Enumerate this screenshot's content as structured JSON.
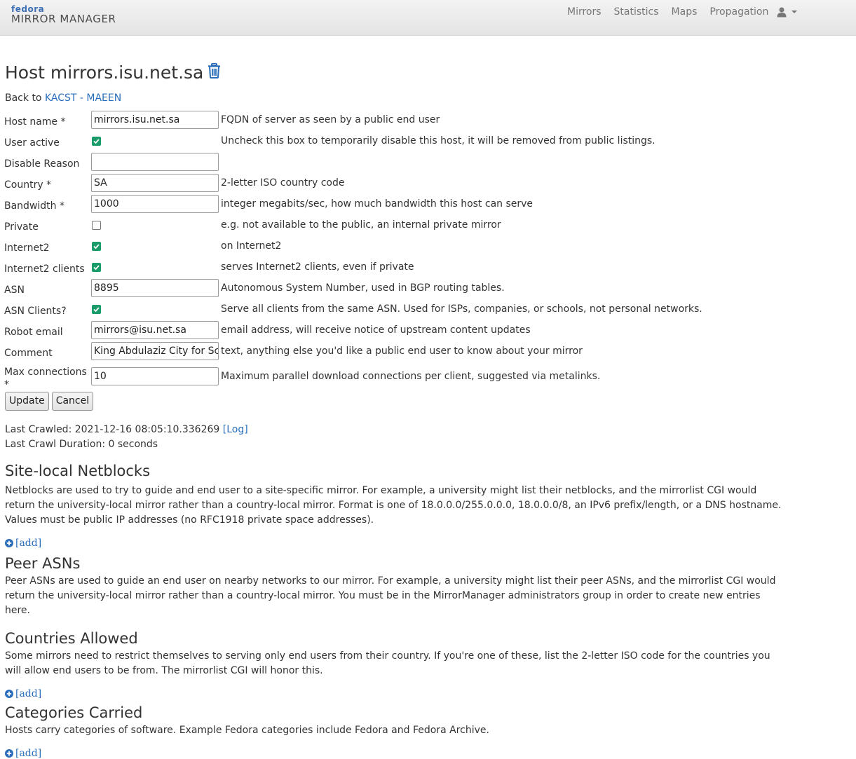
{
  "brand": {
    "top": "fedora",
    "main": "MIRROR MANAGER"
  },
  "nav": {
    "items": [
      "Mirrors",
      "Statistics",
      "Maps",
      "Propagation"
    ]
  },
  "page": {
    "title": "Host mirrors.isu.net.sa",
    "back_prefix": "Back to",
    "back_link": "KACST - MAEEN"
  },
  "form": {
    "host_name": {
      "label": "Host name *",
      "value": "mirrors.isu.net.sa",
      "hint": "FQDN of server as seen by a public end user"
    },
    "user_active": {
      "label": "User active",
      "checked": true,
      "hint": "Uncheck this box to temporarily disable this host, it will be removed from public listings."
    },
    "disable_reason": {
      "label": "Disable Reason",
      "value": "",
      "hint": ""
    },
    "country": {
      "label": "Country *",
      "value": "SA",
      "hint": "2-letter ISO country code"
    },
    "bandwidth": {
      "label": "Bandwidth *",
      "value": "1000",
      "hint": "integer megabits/sec, how much bandwidth this host can serve"
    },
    "private": {
      "label": "Private",
      "checked": false,
      "hint": "e.g. not available to the public, an internal private mirror"
    },
    "internet2": {
      "label": "Internet2",
      "checked": true,
      "hint": "on Internet2"
    },
    "internet2_clients": {
      "label": "Internet2 clients",
      "checked": true,
      "hint": "serves Internet2 clients, even if private"
    },
    "asn": {
      "label": "ASN",
      "value": "8895",
      "hint": "Autonomous System Number, used in BGP routing tables."
    },
    "asn_clients": {
      "label": "ASN Clients?",
      "checked": true,
      "hint": "Serve all clients from the same ASN. Used for ISPs, companies, or schools, not personal networks."
    },
    "robot_email": {
      "label": "Robot email",
      "value": "mirrors@isu.net.sa",
      "hint": "email address, will receive notice of upstream content updates"
    },
    "comment": {
      "label": "Comment",
      "value": "King Abdulaziz City for Science",
      "hint": "text, anything else you'd like a public end user to know about your mirror"
    },
    "max_connections": {
      "label": "Max connections *",
      "value": "10",
      "hint": "Maximum parallel download connections per client, suggested via metalinks."
    },
    "update_label": "Update",
    "cancel_label": "Cancel"
  },
  "crawl": {
    "last_crawled": "Last Crawled: 2021-12-16 08:05:10.336269",
    "log_link": "[Log]",
    "duration": "Last Crawl Duration: 0 seconds"
  },
  "sections": {
    "netblocks": {
      "title": "Site-local Netblocks",
      "desc": "Netblocks are used to try to guide and end user to a site-specific mirror. For example, a university might list their netblocks, and the mirrorlist CGI would return the university-local mirror rather than a country-local mirror. Format is one of 18.0.0.0/255.0.0.0, 18.0.0.0/8, an IPv6 prefix/length, or a DNS hostname. Values must be public IP addresses (no RFC1918 private space addresses).",
      "add": "[add]"
    },
    "peer_asns": {
      "title": "Peer ASNs",
      "desc": "Peer ASNs are used to guide an end user on nearby networks to our mirror. For example, a university might list their peer ASNs, and the mirrorlist CGI would return the university-local mirror rather than a country-local mirror. You must be in the MirrorManager administrators group in order to create new entries here."
    },
    "countries": {
      "title": "Countries Allowed",
      "desc": "Some mirrors need to restrict themselves to serving only end users from their country. If you're one of these, list the 2-letter ISO code for the countries you will allow end users to be from. The mirrorlist CGI will honor this.",
      "add": "[add]"
    },
    "categories": {
      "title": "Categories Carried",
      "desc": "Hosts carry categories of software. Example Fedora categories include Fedora and Fedora Archive.",
      "add": "[add]"
    }
  },
  "colors": {
    "link": "#2a6ebb",
    "checkbox": "#1a9c6a",
    "navbar": "#ebebeb"
  }
}
